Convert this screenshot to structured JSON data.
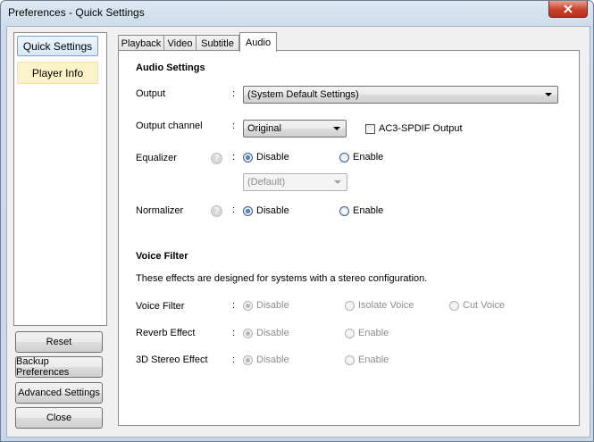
{
  "window": {
    "title": "Preferences - Quick Settings",
    "close_icon": "close-icon"
  },
  "sidebar": {
    "items": [
      {
        "label": "Quick Settings"
      },
      {
        "label": "Player Info"
      }
    ],
    "buttons": {
      "reset": "Reset",
      "backup": "Backup Preferences",
      "advanced": "Advanced Settings",
      "close": "Close"
    }
  },
  "tabs": [
    {
      "label": "Playback"
    },
    {
      "label": "Video"
    },
    {
      "label": "Subtitle"
    },
    {
      "label": "Audio",
      "active": true
    }
  ],
  "audio": {
    "section_title": "Audio Settings",
    "colon": ":",
    "output": {
      "label": "Output",
      "value": "(System Default Settings)"
    },
    "output_channel": {
      "label": "Output channel",
      "value": "Original",
      "spdif_label": "AC3-SPDIF Output",
      "spdif_checked": false
    },
    "equalizer": {
      "label": "Equalizer",
      "help": "?",
      "disable": "Disable",
      "enable": "Enable",
      "selected": "Disable",
      "preset": "(Default)"
    },
    "normalizer": {
      "label": "Normalizer",
      "help": "?",
      "disable": "Disable",
      "enable": "Enable",
      "selected": "Disable"
    }
  },
  "voice": {
    "section_title": "Voice Filter",
    "description": "These effects are designed for systems with a stereo configuration.",
    "voice_filter": {
      "label": "Voice Filter",
      "options": [
        "Disable",
        "Isolate Voice",
        "Cut Voice"
      ],
      "selected": "Disable"
    },
    "reverb": {
      "label": "Reverb Effect",
      "options": [
        "Disable",
        "Enable"
      ],
      "selected": "Disable"
    },
    "stereo3d": {
      "label": "3D Stereo Effect",
      "options": [
        "Disable",
        "Enable"
      ],
      "selected": "Disable"
    }
  },
  "colors": {
    "close_red": "#c7402a",
    "nav_highlight": "#fdf3c9",
    "radio_blue": "#1c4f9c"
  }
}
